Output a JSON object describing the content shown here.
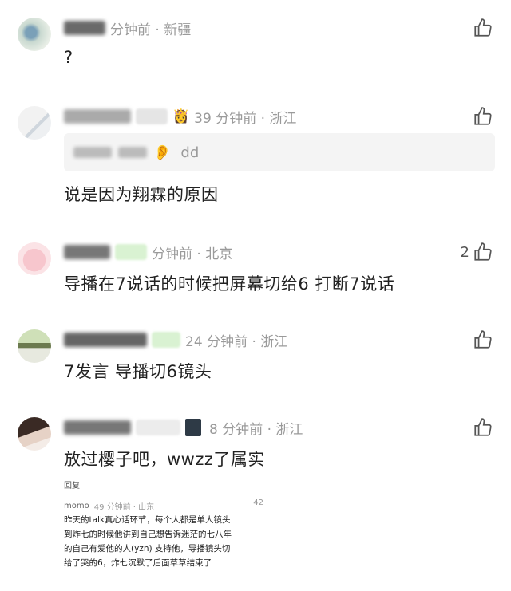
{
  "comments": [
    {
      "time": "分钟前 · 新疆",
      "text": "?",
      "like_count": ""
    },
    {
      "time": "39 分钟前 · 浙江",
      "quote": "dd",
      "text": "说是因为翔霖的原因",
      "like_count": ""
    },
    {
      "time": "分钟前 · 北京",
      "text": "导播在7说话的时候把屏幕切给6 打断7说话",
      "like_count": "2"
    },
    {
      "time": "24 分钟前 · 浙江",
      "text": "7发言 导播切6镜头",
      "like_count": ""
    },
    {
      "time": "8 分钟前 · 浙江",
      "text": "放过樱子吧，wwzz了属实",
      "like_count": ""
    }
  ],
  "reply_label": "回复",
  "embedded": {
    "author": "momo",
    "time": "49 分钟前 · 山东",
    "count": "42",
    "lines": [
      "昨天的talk真心话环节，每个人都是单人镜头",
      "到炸七的时候他讲到自己想告诉迷茫的七八年",
      "的自己有爱他的人(yzn) 支持他，导播镜头切",
      "给了哭的6，炸七沉默了后面草草结束了"
    ]
  },
  "icons": {
    "like": "thumbs-up-icon",
    "ear": "ear-emoji",
    "crown": "person-emoji"
  }
}
